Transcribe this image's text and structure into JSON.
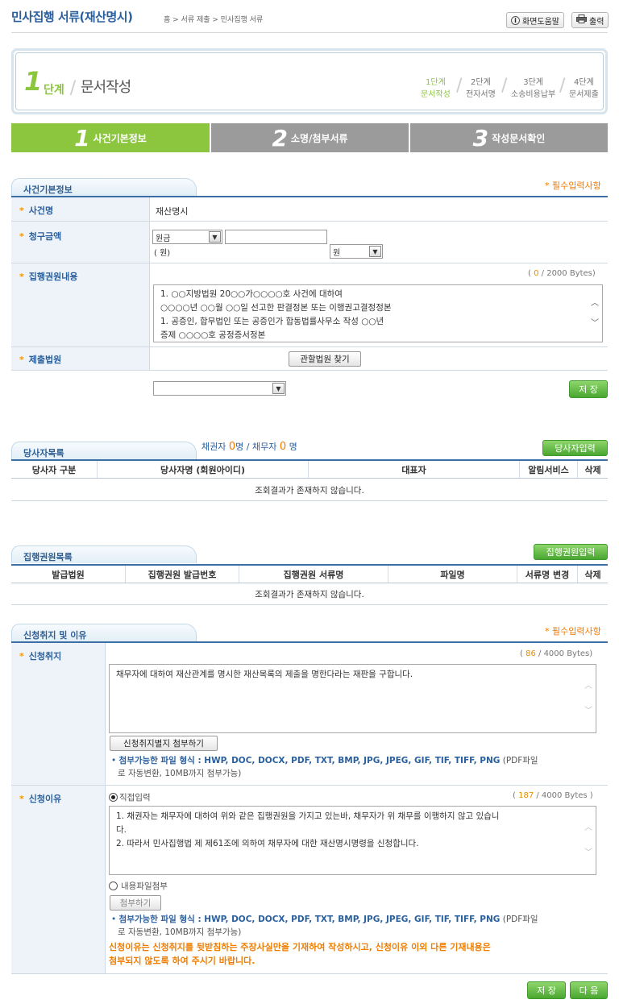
{
  "header": {
    "title": "민사집행 서류(재산명시)",
    "breadcrumb": "홈 > 서류 제출 > 민사집행 서류",
    "help_btn": "화면도움말",
    "print_btn": "출력"
  },
  "step": {
    "num": "1",
    "dan": "단계",
    "title": "문서작성",
    "items": [
      {
        "a": "1단계",
        "b": "문서작성"
      },
      {
        "a": "2단계",
        "b": "전자서명"
      },
      {
        "a": "3단계",
        "b": "소송비용납부"
      },
      {
        "a": "4단계",
        "b": "문서제출"
      }
    ]
  },
  "tabs": [
    {
      "num": "1",
      "label": "사건기본정보"
    },
    {
      "num": "2",
      "label": "소명/첨부서류"
    },
    {
      "num": "3",
      "label": "작성문서확인"
    }
  ],
  "colors": {
    "active_tab": "#8cc63e",
    "inactive_tab": "#9b9b9b",
    "accent": "#2a5f9e",
    "required": "#f07a00"
  },
  "basic": {
    "header": "사건기본정보",
    "required_note": "* 필수입력사항",
    "case_label": "사건명",
    "case_value": "재산명시",
    "claim_label": "청구금액",
    "claim_type": "원금",
    "claim_unit": "원",
    "claim_unit_note": "( 원)",
    "exec_label": "집행권원내용",
    "exec_count_used": "0",
    "exec_count_max": "/ 2000 Bytes)",
    "exec_lines": [
      "1. ○○지방법원  20○○가○○○○호 사건에 대하여",
      "○○○○년 ○○월 ○○일 선고한 판결정본 또는 이행권고결정정본",
      "1. 공증인, 합무법인 또는 공증인가 합동법률사무소 작성 ○○년",
      "증제 ○○○○호 공정증서정본"
    ],
    "court_label": "제출법원",
    "court_find_btn": "관할법원 찾기",
    "save_btn": "저 장"
  },
  "parties": {
    "header": "당사자목록",
    "creditor_label": "채권자",
    "creditor_count": "0",
    "debtor_label": "명 / 채무자",
    "debtor_count": "0",
    "unit": "명",
    "input_btn": "당사자입력",
    "columns": [
      "당사자 구분",
      "당사자명 (회원아이디)",
      "대표자",
      "알림서비스",
      "삭제"
    ],
    "empty": "조회결과가 존재하지 않습니다."
  },
  "titles": {
    "header": "집행권원목록",
    "input_btn": "집행권원입력",
    "columns": [
      "발급법원",
      "집행권원 발급번호",
      "집행권원 서류명",
      "파일명",
      "서류명 변경",
      "삭제"
    ],
    "empty": "조회결과가 존재하지 않습니다."
  },
  "purpose": {
    "header": "신청취지 및 이유",
    "required_note": "* 필수입력사항",
    "aim_label": "신청취지",
    "aim_count_used": "86",
    "aim_count_max": "/ 4000 Bytes)",
    "aim_text": "채무자에 대하여 재산관계를 명시한 재산목록의 제출을 명한다라는 재판을 구합니다.",
    "aim_attach_btn": "신청취지별지 첨부하기",
    "file_note_b": "첨부가능한 파일 형식 : HWP, DOC, DOCX, PDF, TXT, BMP, JPG, JPEG, GIF, TIF, TIFF, PNG",
    "file_note_tail": "(PDF파일",
    "file_note_2": "로 자동변환, 10MB까지 첨부가능)",
    "reason_label": "신청이유",
    "direct_label": "직접입력",
    "reason_count_used": "187",
    "reason_count_max": "/ 4000 Bytes )",
    "reason_lines": [
      "1. 채권자는 채무자에 대하여 위와 같은 집행권원을 가지고 있는바, 채무자가 위 채무를 이행하지 않고 있습니",
      "다.",
      "2. 따라서 민사집행법 제 제61조에 의하여 채무자에 대한 재산명시명령을 신청합니다."
    ],
    "file_attach_label": "내용파일첨부",
    "attach_btn": "첨부하기",
    "warn_1": "신청이유는 신청취지를 뒷받침하는 주장사실만을 기재하여 작성하시고, 신청이유 이외 다른 기재내용은",
    "warn_2": "첨부되지 않도록 하여 주시기 바랍니다."
  },
  "footer": {
    "save_btn": "저 장",
    "next_btn": "다 음"
  }
}
